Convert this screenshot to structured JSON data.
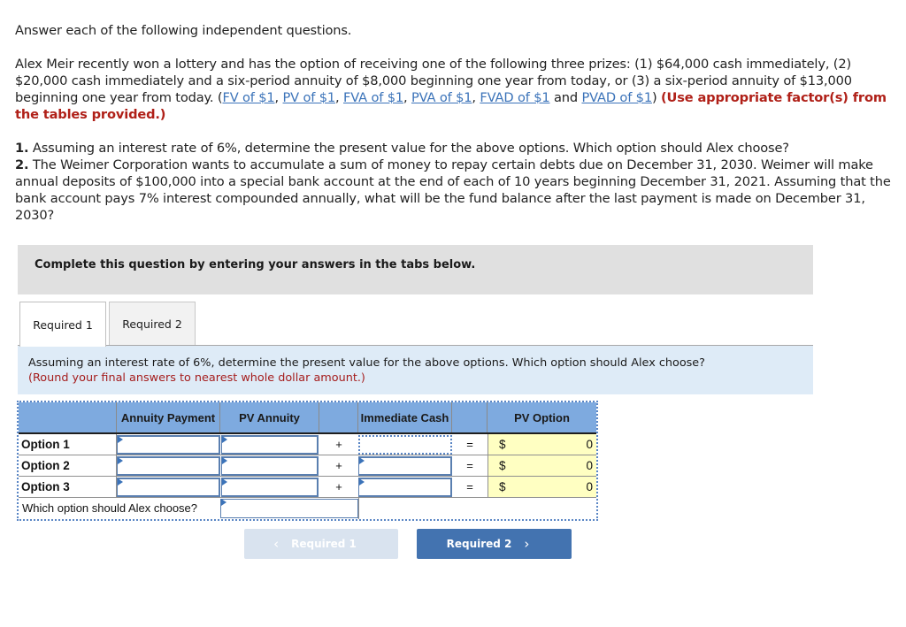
{
  "question": {
    "intro": "Answer each of the following independent questions.",
    "para1_text": "Alex Meir recently won a lottery and has the option of receiving one of the following three prizes: (1) $64,000 cash immediately, (2) $20,000 cash immediately and a six-period annuity of $8,000 beginning one year from today, or (3) a six-period annuity of $13,000 beginning one year from today. (",
    "links": [
      "FV of $1",
      "PV of $1",
      "FVA of $1",
      "PVA of $1",
      "FVAD of $1",
      "PVAD of $1"
    ],
    "sep_comma": ", ",
    "sep_and": " and ",
    "close_paren": ") ",
    "instruction_red": "(Use appropriate factor(s) from the tables provided.)",
    "item1_num": "1.",
    "item1_text": " Assuming an interest rate of 6%, determine the present value for the above options. Which option should Alex choose?",
    "item2_num": "2.",
    "item2_text": " The Weimer Corporation wants to accumulate a sum of money to repay certain debts due on December 31, 2030. Weimer will make annual deposits of $100,000 into a special bank account at the end of each of 10 years beginning December 31, 2021. Assuming that the bank account pays 7% interest compounded annually, what will be the fund balance after the last payment is made on December 31, 2030?"
  },
  "banner": "Complete this question by entering your answers in the tabs below.",
  "tabs": [
    {
      "label": "Required 1",
      "active": true
    },
    {
      "label": "Required 2",
      "active": false
    }
  ],
  "instructions": {
    "text": "Assuming an interest rate of 6%, determine the present value for the above options. Which option should Alex choose?",
    "note": "(Round your final answers to nearest whole dollar amount.)"
  },
  "table": {
    "headers": {
      "annuity_payment": "Annuity Payment",
      "pv_annuity": "PV Annuity",
      "immediate_cash": "Immediate Cash",
      "pv_option": "PV Option"
    },
    "plus": "+",
    "equals": "=",
    "currency": "$",
    "rows": [
      {
        "label": "Option 1",
        "annuity_payment": "",
        "pv_annuity": "",
        "immediate_cash": "",
        "pv_option": "0"
      },
      {
        "label": "Option 2",
        "annuity_payment": "",
        "pv_annuity": "",
        "immediate_cash": "",
        "pv_option": "0"
      },
      {
        "label": "Option 3",
        "annuity_payment": "",
        "pv_annuity": "",
        "immediate_cash": "",
        "pv_option": "0"
      }
    ],
    "choose_label": "Which option should Alex choose?",
    "choose_value": ""
  },
  "nav": {
    "prev_label": "Required 1",
    "next_label": "Required 2",
    "prev_icon": "‹",
    "next_icon": "›"
  },
  "colors": {
    "link": "#3b73b9",
    "emphasis_red": "#b02018",
    "header_blue": "#7eaadf",
    "instruction_bg": "#deebf7",
    "pv_cell_bg": "#ffffc2",
    "next_button": "#4373b0",
    "prev_button_disabled": "#d9e3ef"
  }
}
